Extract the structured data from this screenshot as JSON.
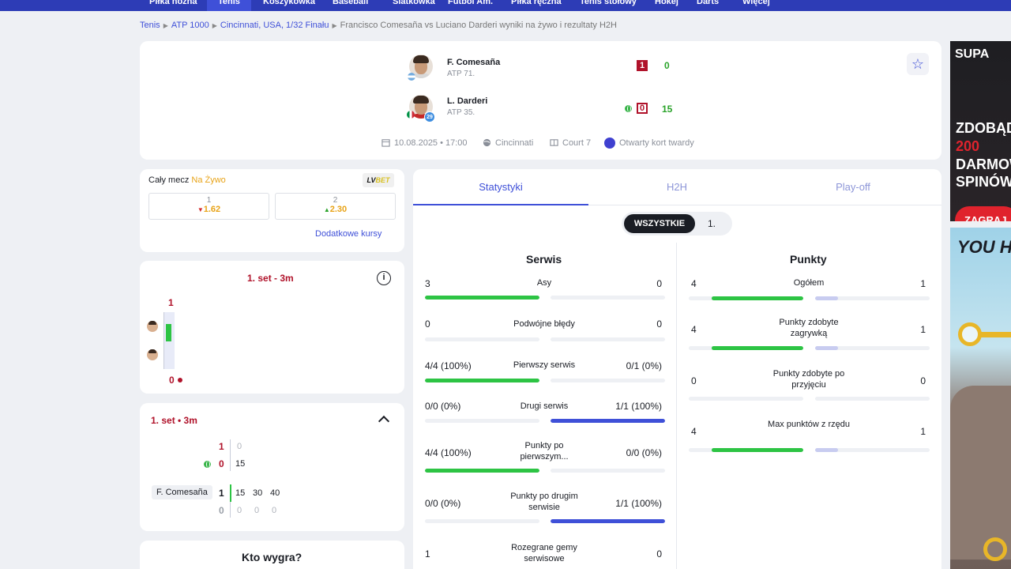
{
  "nav": {
    "items": [
      "Piłka nożna",
      "Tenis",
      "Koszykówka",
      "Baseball",
      "Siatkówka",
      "Futbol Am.",
      "Piłka ręczna",
      "Tenis stołowy",
      "Hokej",
      "Darts",
      "Więcej"
    ],
    "active": "Tenis"
  },
  "breadcrumb": [
    "Tenis",
    "ATP 1000",
    "Cincinnati, USA, 1/32 Finału",
    "Francisco Comesaña vs Luciano Darderi wyniki na żywo i rezultaty H2H"
  ],
  "match": {
    "player1": {
      "name": "F. Comesaña",
      "rank": "ATP 71.",
      "sets": "1",
      "games": "0"
    },
    "player2": {
      "name": "L. Darderi",
      "rank": "ATP 35.",
      "seed": "29",
      "sets": "0",
      "games": "15"
    },
    "date": "10.08.2025 • 17:00",
    "location": "Cincinnati",
    "court": "Court 7",
    "surface": "Otwarty kort twardy",
    "colors": {
      "accent": "#3f50d8",
      "score_red": "#b0122a",
      "green": "#2dc444"
    }
  },
  "odds": {
    "label": "Cały mecz",
    "live": "Na Żywo",
    "bookmaker": "LV BET",
    "options": [
      {
        "n": "1",
        "v": "1.62",
        "trend": "down"
      },
      {
        "n": "2",
        "v": "2.30",
        "trend": "up"
      }
    ],
    "more": "Dodatkowe kursy"
  },
  "momentum": {
    "title": "1. set - 3m",
    "top": "1",
    "bottom": "0"
  },
  "pbp": {
    "title": "1. set • 3m",
    "row1": {
      "score": "1",
      "prev": "0"
    },
    "row2": {
      "score": "0",
      "prev": "15"
    },
    "game": {
      "server": "F. Comesaña",
      "p1": "1",
      "p2": "0",
      "p1_points": [
        "15",
        "30",
        "40"
      ],
      "p2_points": [
        "0",
        "0",
        "0"
      ]
    }
  },
  "who_wins": "Kto wygra?",
  "stats": {
    "tabs": [
      "Statystyki",
      "H2H",
      "Play-off"
    ],
    "periods": [
      "WSZYSTKIE",
      "1."
    ],
    "serve_title": "Serwis",
    "points_title": "Punkty",
    "serve": [
      {
        "name": "Asy",
        "l": "3",
        "r": "0",
        "lp": 1.0,
        "rp": 0.0
      },
      {
        "name": "Podwójne błędy",
        "l": "0",
        "r": "0",
        "lp": 0.0,
        "rp": 0.0
      },
      {
        "name": "Pierwszy serwis",
        "l": "4/4 (100%)",
        "r": "0/1 (0%)",
        "lp": 1.0,
        "rp": 0.0
      },
      {
        "name": "Drugi serwis",
        "l": "0/0 (0%)",
        "r": "1/1 (100%)",
        "lp": 0.0,
        "rp": 1.0
      },
      {
        "name": "Punkty po pierwszym...",
        "l": "4/4 (100%)",
        "r": "0/0 (0%)",
        "lp": 1.0,
        "rp": 0.0
      },
      {
        "name": "Punkty po drugim serwisie",
        "l": "0/0 (0%)",
        "r": "1/1 (100%)",
        "lp": 0.0,
        "rp": 1.0
      },
      {
        "name": "Rozegrane gemy serwisowe",
        "l": "1",
        "r": "0",
        "lp": 1.0,
        "rp": 0.0
      }
    ],
    "points": [
      {
        "name": "Ogółem",
        "l": "4",
        "r": "1",
        "lp": 0.8,
        "rp": 0.2
      },
      {
        "name": "Punkty zdobyte zagrywką",
        "l": "4",
        "r": "1",
        "lp": 0.8,
        "rp": 0.2
      },
      {
        "name": "Punkty zdobyte po przyjęciu",
        "l": "0",
        "r": "0",
        "lp": 0.0,
        "rp": 0.0
      },
      {
        "name": "Max punktów z rzędu",
        "l": "4",
        "r": "1",
        "lp": 0.8,
        "rp": 0.2
      }
    ]
  },
  "ads": {
    "ad1": {
      "brand": "SUPA",
      "lines": [
        "ZDOBĄD",
        "200",
        "DARMOW",
        "SPINÓW"
      ],
      "cta": "ZAGRAJ"
    },
    "ad2": {
      "text": "YOU HA"
    }
  }
}
